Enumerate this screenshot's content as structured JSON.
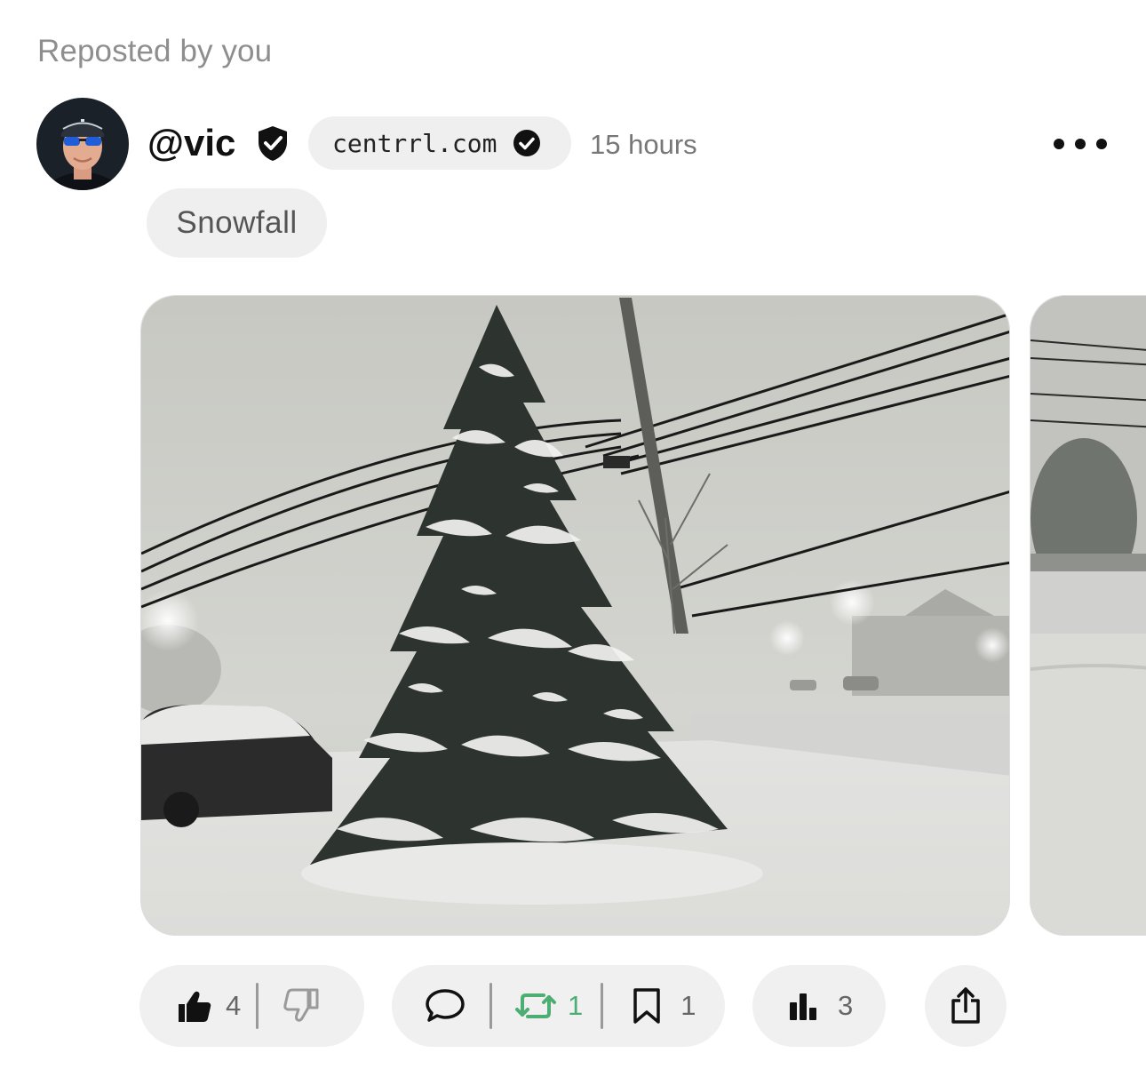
{
  "header": {
    "repost_label": "Reposted by you"
  },
  "author": {
    "handle": "@vic",
    "domain": "centrrl.com",
    "timestamp": "15 hours"
  },
  "post": {
    "topic": "Snowfall"
  },
  "actions": {
    "likes": "4",
    "reposts": "1",
    "bookmarks": "1",
    "views": "3"
  },
  "icons": {
    "verified": "shield-check-icon",
    "domain_verified": "check-circle-icon",
    "more": "ellipsis-icon",
    "like": "thumbs-up-icon",
    "dislike": "thumbs-down-icon",
    "comment": "speech-bubble-icon",
    "repost": "repost-arrows-icon",
    "bookmark": "bookmark-icon",
    "stats": "bar-chart-icon",
    "share": "share-icon"
  },
  "colors": {
    "repost_active": "#4cae73",
    "pill_bg": "#efefef",
    "muted_text": "#8e8e8e"
  }
}
